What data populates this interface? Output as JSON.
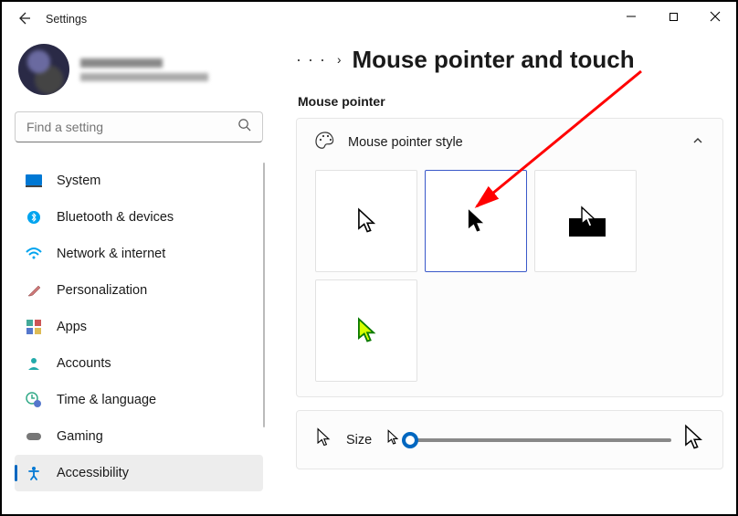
{
  "titlebar": {
    "app_name": "Settings"
  },
  "account": {
    "name_redacted": true
  },
  "search": {
    "placeholder": "Find a setting"
  },
  "nav": {
    "items": [
      {
        "label": "System",
        "icon": "display-icon"
      },
      {
        "label": "Bluetooth & devices",
        "icon": "bluetooth-icon"
      },
      {
        "label": "Network & internet",
        "icon": "wifi-icon"
      },
      {
        "label": "Personalization",
        "icon": "paintbrush-icon"
      },
      {
        "label": "Apps",
        "icon": "apps-icon"
      },
      {
        "label": "Accounts",
        "icon": "person-icon"
      },
      {
        "label": "Time & language",
        "icon": "clock-globe-icon"
      },
      {
        "label": "Gaming",
        "icon": "gamepad-icon"
      },
      {
        "label": "Accessibility",
        "icon": "accessibility-icon"
      }
    ],
    "active_index": 8
  },
  "breadcrumb": {
    "ellipsis": "· · ·",
    "separator": "›",
    "title": "Mouse pointer and touch"
  },
  "section": {
    "label": "Mouse pointer"
  },
  "style_card": {
    "title": "Mouse pointer style",
    "options": [
      {
        "name": "white",
        "selected": false
      },
      {
        "name": "black",
        "selected": true
      },
      {
        "name": "inverted",
        "selected": false
      },
      {
        "name": "custom",
        "selected": false
      }
    ]
  },
  "size_card": {
    "label": "Size",
    "slider": {
      "min": 1,
      "max": 15,
      "value": 1
    }
  },
  "annotation": {
    "type": "arrow",
    "color": "#ff0000",
    "target": "page-title"
  }
}
